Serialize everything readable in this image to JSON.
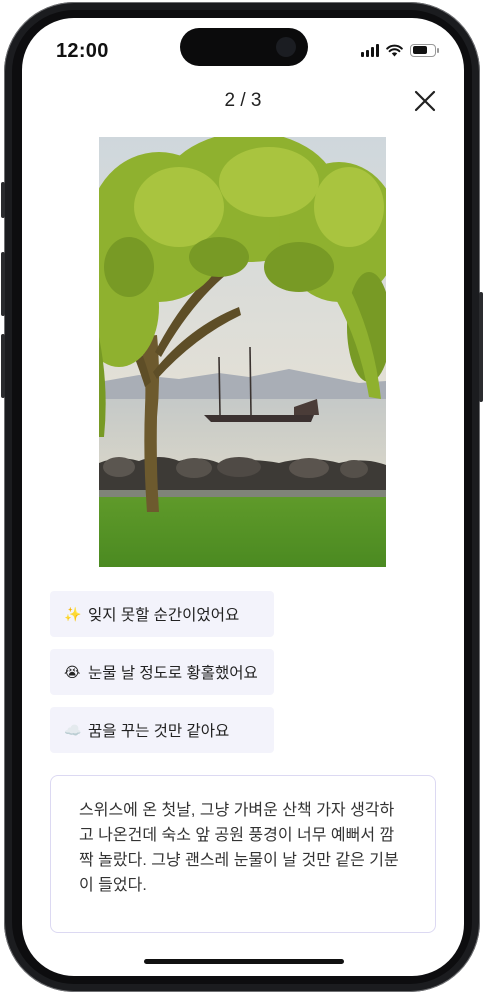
{
  "status_bar": {
    "time": "12:00"
  },
  "header": {
    "page_indicator": "2 / 3"
  },
  "options": [
    {
      "emoji": "✨",
      "label": "잊지 못할 순간이었어요"
    },
    {
      "emoji": "😭",
      "label": "눈물 날 정도로 황홀했어요"
    },
    {
      "emoji": "☁️",
      "label": "꿈을 꾸는 것만 같아요"
    }
  ],
  "memo": {
    "text": "스위스에 온 첫날, 그냥 가벼운 산책 가자 생각하고 나온건데 숙소 앞 공원 풍경이 너무 예뻐서 깜짝 놀랐다. 그냥 괜스레 눈물이 날 것만 같은 기분이 들었다."
  },
  "icons": {
    "close": "close-icon",
    "signal": "cellular-signal-icon",
    "wifi": "wifi-icon",
    "battery": "battery-icon"
  }
}
